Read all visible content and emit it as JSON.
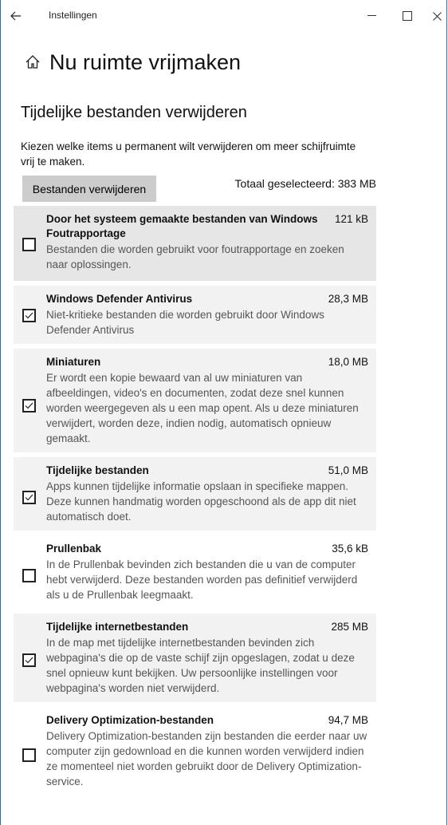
{
  "window": {
    "app_title": "Instellingen",
    "back_icon": "back-arrow-icon",
    "controls": [
      "minimize-icon",
      "maximize-icon",
      "close-icon"
    ]
  },
  "page": {
    "title": "Nu ruimte vrijmaken",
    "title_icon": "home-icon",
    "section_title": "Tijdelijke bestanden verwijderen",
    "description": "Kiezen welke items u permanent wilt verwijderen om meer schijfruimte vrij te maken.",
    "remove_button": "Bestanden verwijderen",
    "total_selected": "Totaal geselecteerd: 383 MB"
  },
  "items": [
    {
      "name": "Door het systeem gemaakte bestanden van Windows Foutrapportage",
      "size": "121 kB",
      "checked": false,
      "description": "Bestanden die worden gebruikt voor foutrapportage en zoeken naar oplossingen."
    },
    {
      "name": "Windows Defender Antivirus",
      "size": "28,3 MB",
      "checked": true,
      "description": "Niet-kritieke bestanden die worden gebruikt door Windows Defender Antivirus"
    },
    {
      "name": "Miniaturen",
      "size": "18,0 MB",
      "checked": true,
      "description": "Er wordt een kopie bewaard van al uw miniaturen van afbeeldingen, video's en documenten, zodat deze snel kunnen worden weergegeven als u een map opent. Als u deze miniaturen verwijdert, worden deze, indien nodig, automatisch opnieuw gemaakt."
    },
    {
      "name": "Tijdelijke bestanden",
      "size": "51,0 MB",
      "checked": true,
      "description": "Apps kunnen tijdelijke informatie opslaan in specifieke mappen. Deze kunnen handmatig worden opgeschoond als de app dit niet automatisch doet."
    },
    {
      "name": "Prullenbak",
      "size": "35,6 kB",
      "checked": false,
      "description": "In de Prullenbak bevinden zich bestanden die u van de computer hebt verwijderd. Deze bestanden worden pas definitief verwijderd als u de Prullenbak leegmaakt."
    },
    {
      "name": "Tijdelijke internetbestanden",
      "size": "285 MB",
      "checked": true,
      "description": "In de map met tijdelijke internetbestanden bevinden zich webpagina's die op de vaste schijf zijn opgeslagen, zodat u deze snel opnieuw kunt bekijken. Uw persoonlijke instellingen voor webpagina's worden niet verwijderd."
    },
    {
      "name": "Delivery Optimization-bestanden",
      "size": "94,7 MB",
      "checked": false,
      "description": "Delivery Optimization-bestanden zijn bestanden die eerder naar uw computer zijn gedownload en die kunnen worden verwijderd indien ze momenteel niet worden gebruikt door de Delivery Optimization-service."
    }
  ]
}
